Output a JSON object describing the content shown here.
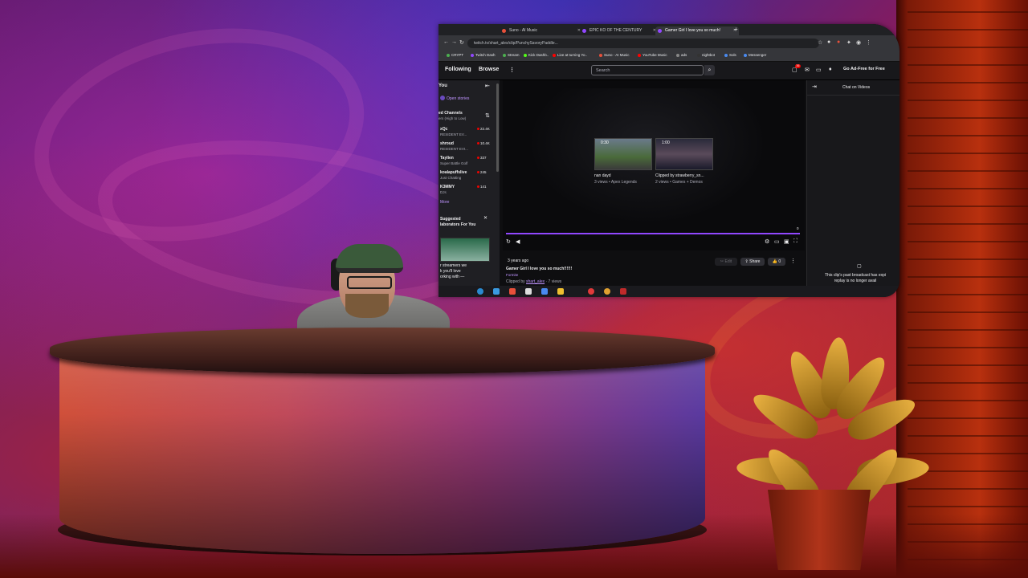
{
  "browser": {
    "tabs": [
      {
        "label": "Suno - AI Music",
        "active": false,
        "fav_color": "#e8503a"
      },
      {
        "label": "EPIC KO OF THE CENTURY",
        "active": false,
        "fav_color": "#9147ff"
      },
      {
        "label": "Gamer Girl I love you so much!",
        "active": true,
        "fav_color": "#9147ff"
      }
    ],
    "new_tab": "+",
    "url": "twitch.tv/shart_alex/clip/PunchySavoryPaddle...",
    "bookmarks": [
      {
        "label": "CRYPT",
        "color": "#4caf50"
      },
      {
        "label": "Twitch Dash",
        "color": "#9147ff"
      },
      {
        "label": "Stream",
        "color": "#4caf50"
      },
      {
        "label": "Kick Dashb..",
        "color": "#53fc18"
      },
      {
        "label": "Live at turning  Yo..",
        "color": "#ff0000"
      },
      {
        "label": "Suno - AI Music",
        "color": "#e8503a"
      },
      {
        "label": "YouTube Music",
        "color": "#ff0000"
      },
      {
        "label": "ads",
        "color": "#888888"
      },
      {
        "label": "nightbot",
        "color": "#333333"
      },
      {
        "label": "Sols",
        "color": "#4a8af0"
      },
      {
        "label": "Messenger",
        "color": "#4a8af0"
      }
    ]
  },
  "twitch": {
    "nav": {
      "following": "Following",
      "browse": "Browse",
      "more": "⋮",
      "search_placeholder": "Search",
      "notification_count": "36",
      "adfree": "Go Ad-Free for Free"
    },
    "sidebar": {
      "heading": "You",
      "stories": "Open stories",
      "section_title": "ed Channels",
      "section_sort": "ers (High to Low)",
      "channels": [
        {
          "name": "xQc",
          "game": "RESIDENT EV...",
          "viewers": "22.4K"
        },
        {
          "name": "shroud",
          "game": "RESIDENT EVI...",
          "viewers": "10.4K"
        },
        {
          "name": "Taylien",
          "game": "Super Battle Golf",
          "viewers": "337"
        },
        {
          "name": "koalapuffslive",
          "game": "Just Chatting",
          "viewers": "245"
        },
        {
          "name": "K3MMY",
          "game": "DJs",
          "viewers": "141"
        }
      ],
      "more": "More",
      "suggested_heading": "Suggested\nlaborators For You\n",
      "suggested_text": "r streamers we\nk you'll love\norking with —"
    },
    "player": {
      "recommendations": [
        {
          "duration": "0:30",
          "title": "nan dayd",
          "meta": "3 views • Apex Legends"
        },
        {
          "duration": "1:00",
          "title": "Clipped by strawberry_sn...",
          "meta": "2 views • Games + Demos"
        }
      ],
      "progress_end": "0",
      "progress": 1.0
    },
    "clip": {
      "ago": "3 years ago",
      "title": "Gamer Girl I love you so much!!!!!!",
      "game": "Fortnite",
      "clipped_by_label": "Clipped by",
      "clipped_by": "shart_alex",
      "views": "· 7 views",
      "edit": "Edit",
      "share": "Share",
      "likes": "0"
    },
    "chat": {
      "title": "Chat on Videos",
      "message": "This clip's past broadcast has expi\nreplay is no longer avail"
    }
  },
  "colors": {
    "twitch_purple": "#9147ff",
    "twitch_bg": "#0e0e10",
    "live_red": "#eb0400"
  }
}
